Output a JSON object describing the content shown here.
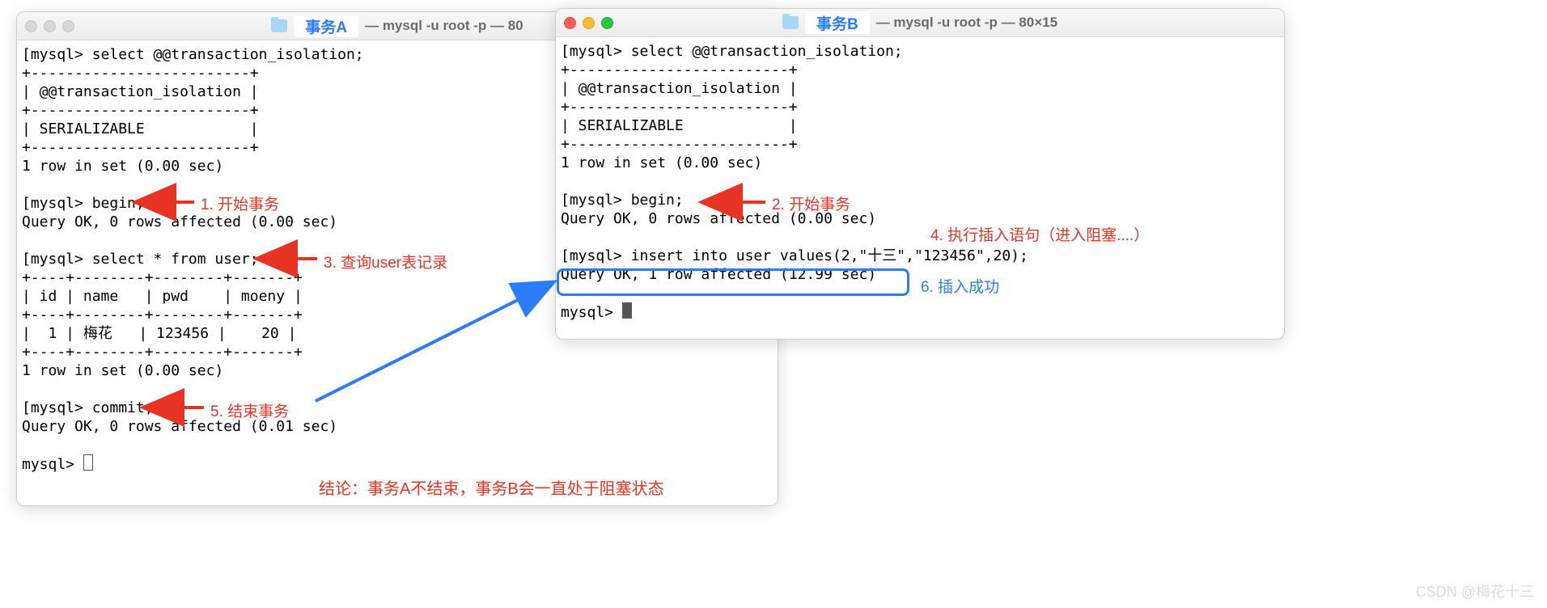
{
  "windowA": {
    "titlebar": {
      "tx_label": "事务A",
      "title_rest": "— mysql -u root -p — 80"
    },
    "lines": [
      "[mysql> select @@transaction_isolation;",
      "+-------------------------+",
      "| @@transaction_isolation |",
      "+-------------------------+",
      "| SERIALIZABLE            |",
      "+-------------------------+",
      "1 row in set (0.00 sec)",
      "",
      "[mysql> begin;",
      "Query OK, 0 rows affected (0.00 sec)",
      "",
      "[mysql> select * from user;",
      "+----+--------+--------+-------+",
      "| id | name   | pwd    | moeny |",
      "+----+--------+--------+-------+",
      "|  1 | 梅花   | 123456 |    20 |",
      "+----+--------+--------+-------+",
      "1 row in set (0.00 sec)",
      "",
      "[mysql> commit;",
      "Query OK, 0 rows affected (0.01 sec)",
      "",
      "mysql> "
    ]
  },
  "windowB": {
    "titlebar": {
      "tx_label": "事务B",
      "title_rest": "— mysql -u root -p — 80×15"
    },
    "lines": [
      "[mysql> select @@transaction_isolation;",
      "+-------------------------+",
      "| @@transaction_isolation |",
      "+-------------------------+",
      "| SERIALIZABLE            |",
      "+-------------------------+",
      "1 row in set (0.00 sec)",
      "",
      "[mysql> begin;",
      "Query OK, 0 rows affected (0.00 sec)",
      "",
      "[mysql> insert into user values(2,\"十三\",\"123456\",20);",
      "Query OK, 1 row affected (12.99 sec)",
      "",
      "mysql> "
    ]
  },
  "annotations": {
    "a1": "1. 开始事务",
    "a2": "2. 开始事务",
    "a3": "3. 查询user表记录",
    "a4": "4. 执行插入语句（进入阻塞....）",
    "a5": "5. 结束事务",
    "a6": "6. 插入成功"
  },
  "conclusion": "结论：事务A不结束，事务B会一直处于阻塞状态",
  "watermark": "CSDN @梅花十三"
}
